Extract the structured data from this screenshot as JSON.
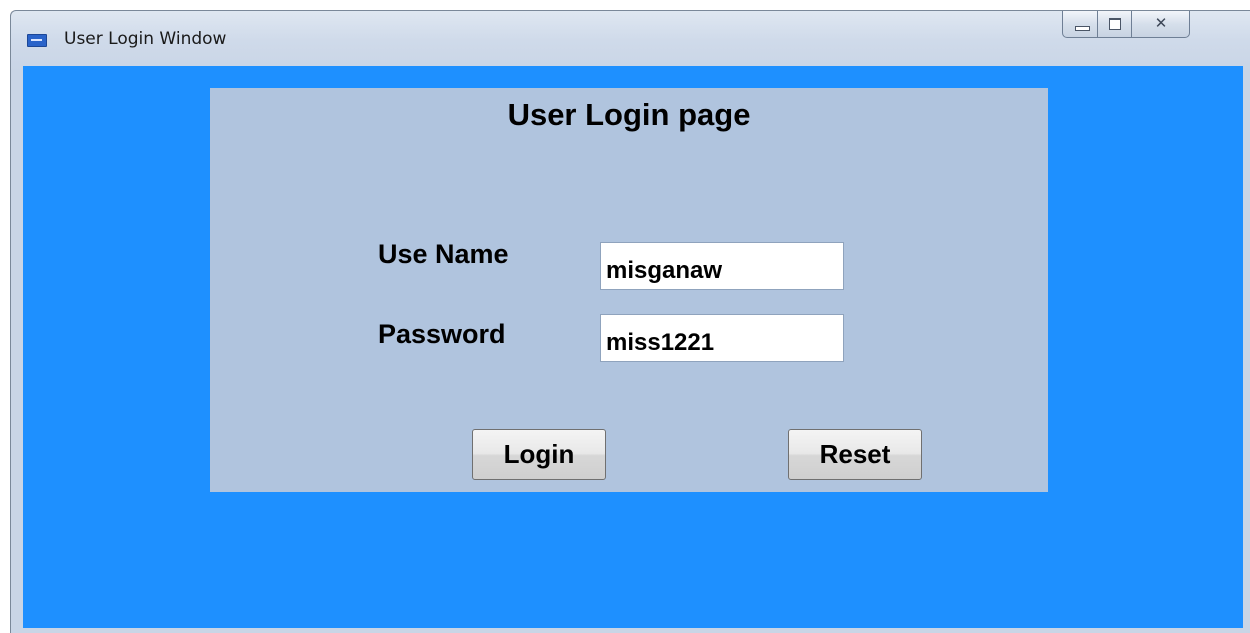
{
  "window": {
    "title": "User Login Window",
    "icon": "app-window-icon",
    "caption_buttons": {
      "minimize": "minimize-icon",
      "maximize": "maximize-icon",
      "close_glyph": "☒"
    }
  },
  "form": {
    "heading": "User Login page",
    "username_label": "Use Name",
    "username_value": "misganaw",
    "password_label": "Password",
    "password_value": "miss1221",
    "login_label": "Login",
    "reset_label": "Reset"
  },
  "colors": {
    "client_background": "#1e90ff",
    "panel_background": "#b0c4de"
  }
}
